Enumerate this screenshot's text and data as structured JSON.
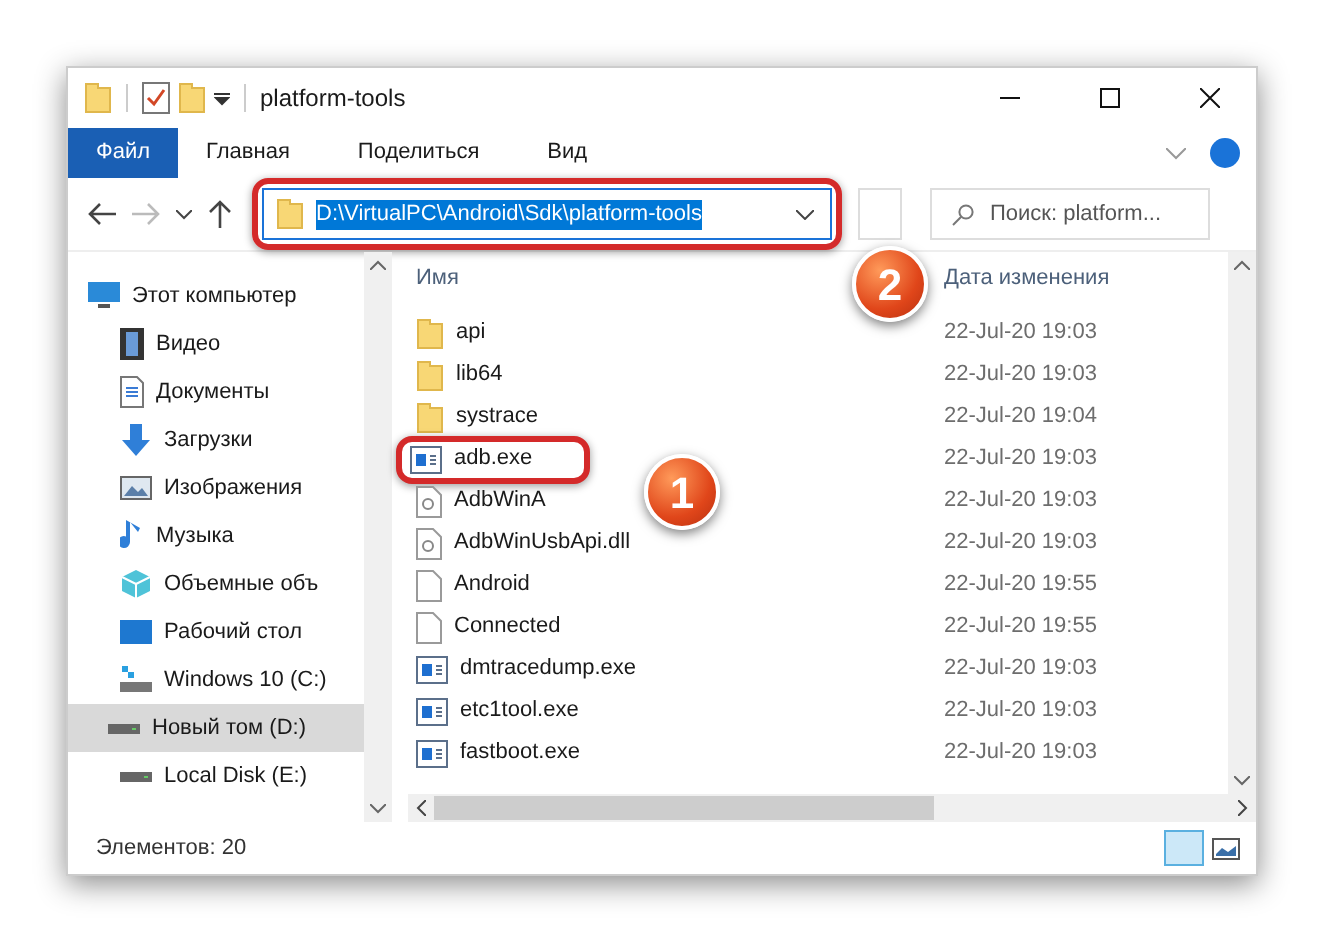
{
  "window": {
    "title": "platform-tools"
  },
  "ribbon_tabs": [
    {
      "label": "Файл",
      "kind": "file",
      "selected": false
    },
    {
      "label": "Главная",
      "kind": "tab",
      "selected": false
    },
    {
      "label": "Поделиться",
      "kind": "tab",
      "selected": false
    },
    {
      "label": "Вид",
      "kind": "tab",
      "selected": false
    }
  ],
  "address": {
    "path": "D:\\VirtualPC\\Android\\Sdk\\platform-tools",
    "badge": "2"
  },
  "search": {
    "placeholder": "Поиск: platform..."
  },
  "sidebar": {
    "items": [
      {
        "label": "Этот компьютер",
        "kind": "pc",
        "selected": false
      },
      {
        "label": "Видео",
        "kind": "video",
        "selected": false
      },
      {
        "label": "Документы",
        "kind": "docs",
        "selected": false
      },
      {
        "label": "Загрузки",
        "kind": "downloads",
        "selected": false
      },
      {
        "label": "Изображения",
        "kind": "images",
        "selected": false
      },
      {
        "label": "Музыка",
        "kind": "music",
        "selected": false
      },
      {
        "label": "Объемные объ",
        "kind": "cube",
        "selected": false
      },
      {
        "label": "Рабочий стол",
        "kind": "desktop",
        "selected": false
      },
      {
        "label": "Windows 10 (C:)",
        "kind": "windrive",
        "selected": false
      },
      {
        "label": "Новый том (D:)",
        "kind": "drive",
        "selected": true
      },
      {
        "label": "Local Disk (E:)",
        "kind": "drive",
        "selected": false
      }
    ]
  },
  "table": {
    "columns": [
      "Имя",
      "Дата изменения"
    ],
    "rows": [
      {
        "name": "api",
        "kind": "folder",
        "date": "22-Jul-20 19:03"
      },
      {
        "name": "lib64",
        "kind": "folder",
        "date": "22-Jul-20 19:03"
      },
      {
        "name": "systrace",
        "kind": "folder",
        "date": "22-Jul-20 19:04"
      },
      {
        "name": "adb.exe",
        "kind": "exe",
        "date": "22-Jul-20 19:03",
        "highlighted": true,
        "badge": "1"
      },
      {
        "name": "AdbWinA",
        "kind": "dll",
        "date": "22-Jul-20 19:03"
      },
      {
        "name": "AdbWinUsbApi.dll",
        "kind": "dll",
        "date": "22-Jul-20 19:03"
      },
      {
        "name": "Android",
        "kind": "file",
        "date": "22-Jul-20 19:55"
      },
      {
        "name": "Connected",
        "kind": "file",
        "date": "22-Jul-20 19:55"
      },
      {
        "name": "dmtracedump.exe",
        "kind": "exe",
        "date": "22-Jul-20 19:03"
      },
      {
        "name": "etc1tool.exe",
        "kind": "exe",
        "date": "22-Jul-20 19:03"
      },
      {
        "name": "fastboot.exe",
        "kind": "exe",
        "date": "22-Jul-20 19:03"
      }
    ]
  },
  "status_bar": {
    "text": "Элементов: 20"
  }
}
